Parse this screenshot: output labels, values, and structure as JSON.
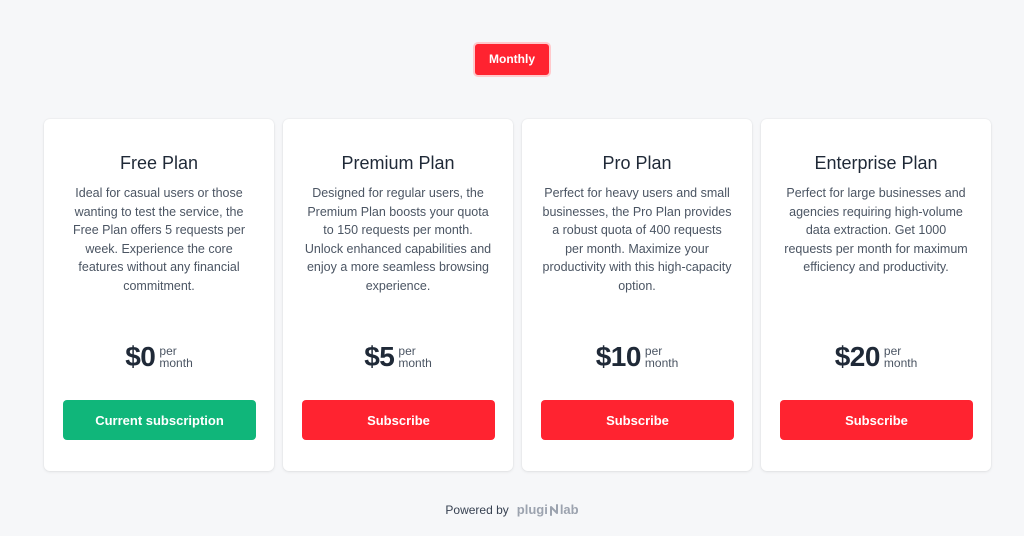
{
  "billing_toggle": {
    "label": "Monthly"
  },
  "plans": [
    {
      "name": "Free Plan",
      "description": "Ideal for casual users or those wanting to test the service, the Free Plan offers 5 requests per week. Experience the core features without any financial commitment.",
      "price": "$0",
      "period_line1": "per",
      "period_line2": "month",
      "cta": "Current subscription"
    },
    {
      "name": "Premium Plan",
      "description": "Designed for regular users, the Premium Plan boosts your quota to 150 requests per month. Unlock enhanced capabilities and enjoy a more seamless browsing experience.",
      "price": "$5",
      "period_line1": "per",
      "period_line2": "month",
      "cta": "Subscribe"
    },
    {
      "name": "Pro Plan",
      "description": "Perfect for heavy users and small businesses, the Pro Plan provides a robust quota of 400 requests per month. Maximize your productivity with this high-capacity option.",
      "price": "$10",
      "period_line1": "per",
      "period_line2": "month",
      "cta": "Subscribe"
    },
    {
      "name": "Enterprise Plan",
      "description": "Perfect for large businesses and agencies requiring high-volume data extraction. Get 1000 requests per month for maximum efficiency and productivity.",
      "price": "$20",
      "period_line1": "per",
      "period_line2": "month",
      "cta": "Subscribe"
    }
  ],
  "footer": {
    "powered_by": "Powered by",
    "brand_part1": "plugi",
    "brand_part2": "lab",
    "brand_icon": "plugin-lab-logo-mark"
  },
  "colors": {
    "accent": "#ff2330",
    "success": "#10b67a",
    "background": "#f6f7f9"
  }
}
